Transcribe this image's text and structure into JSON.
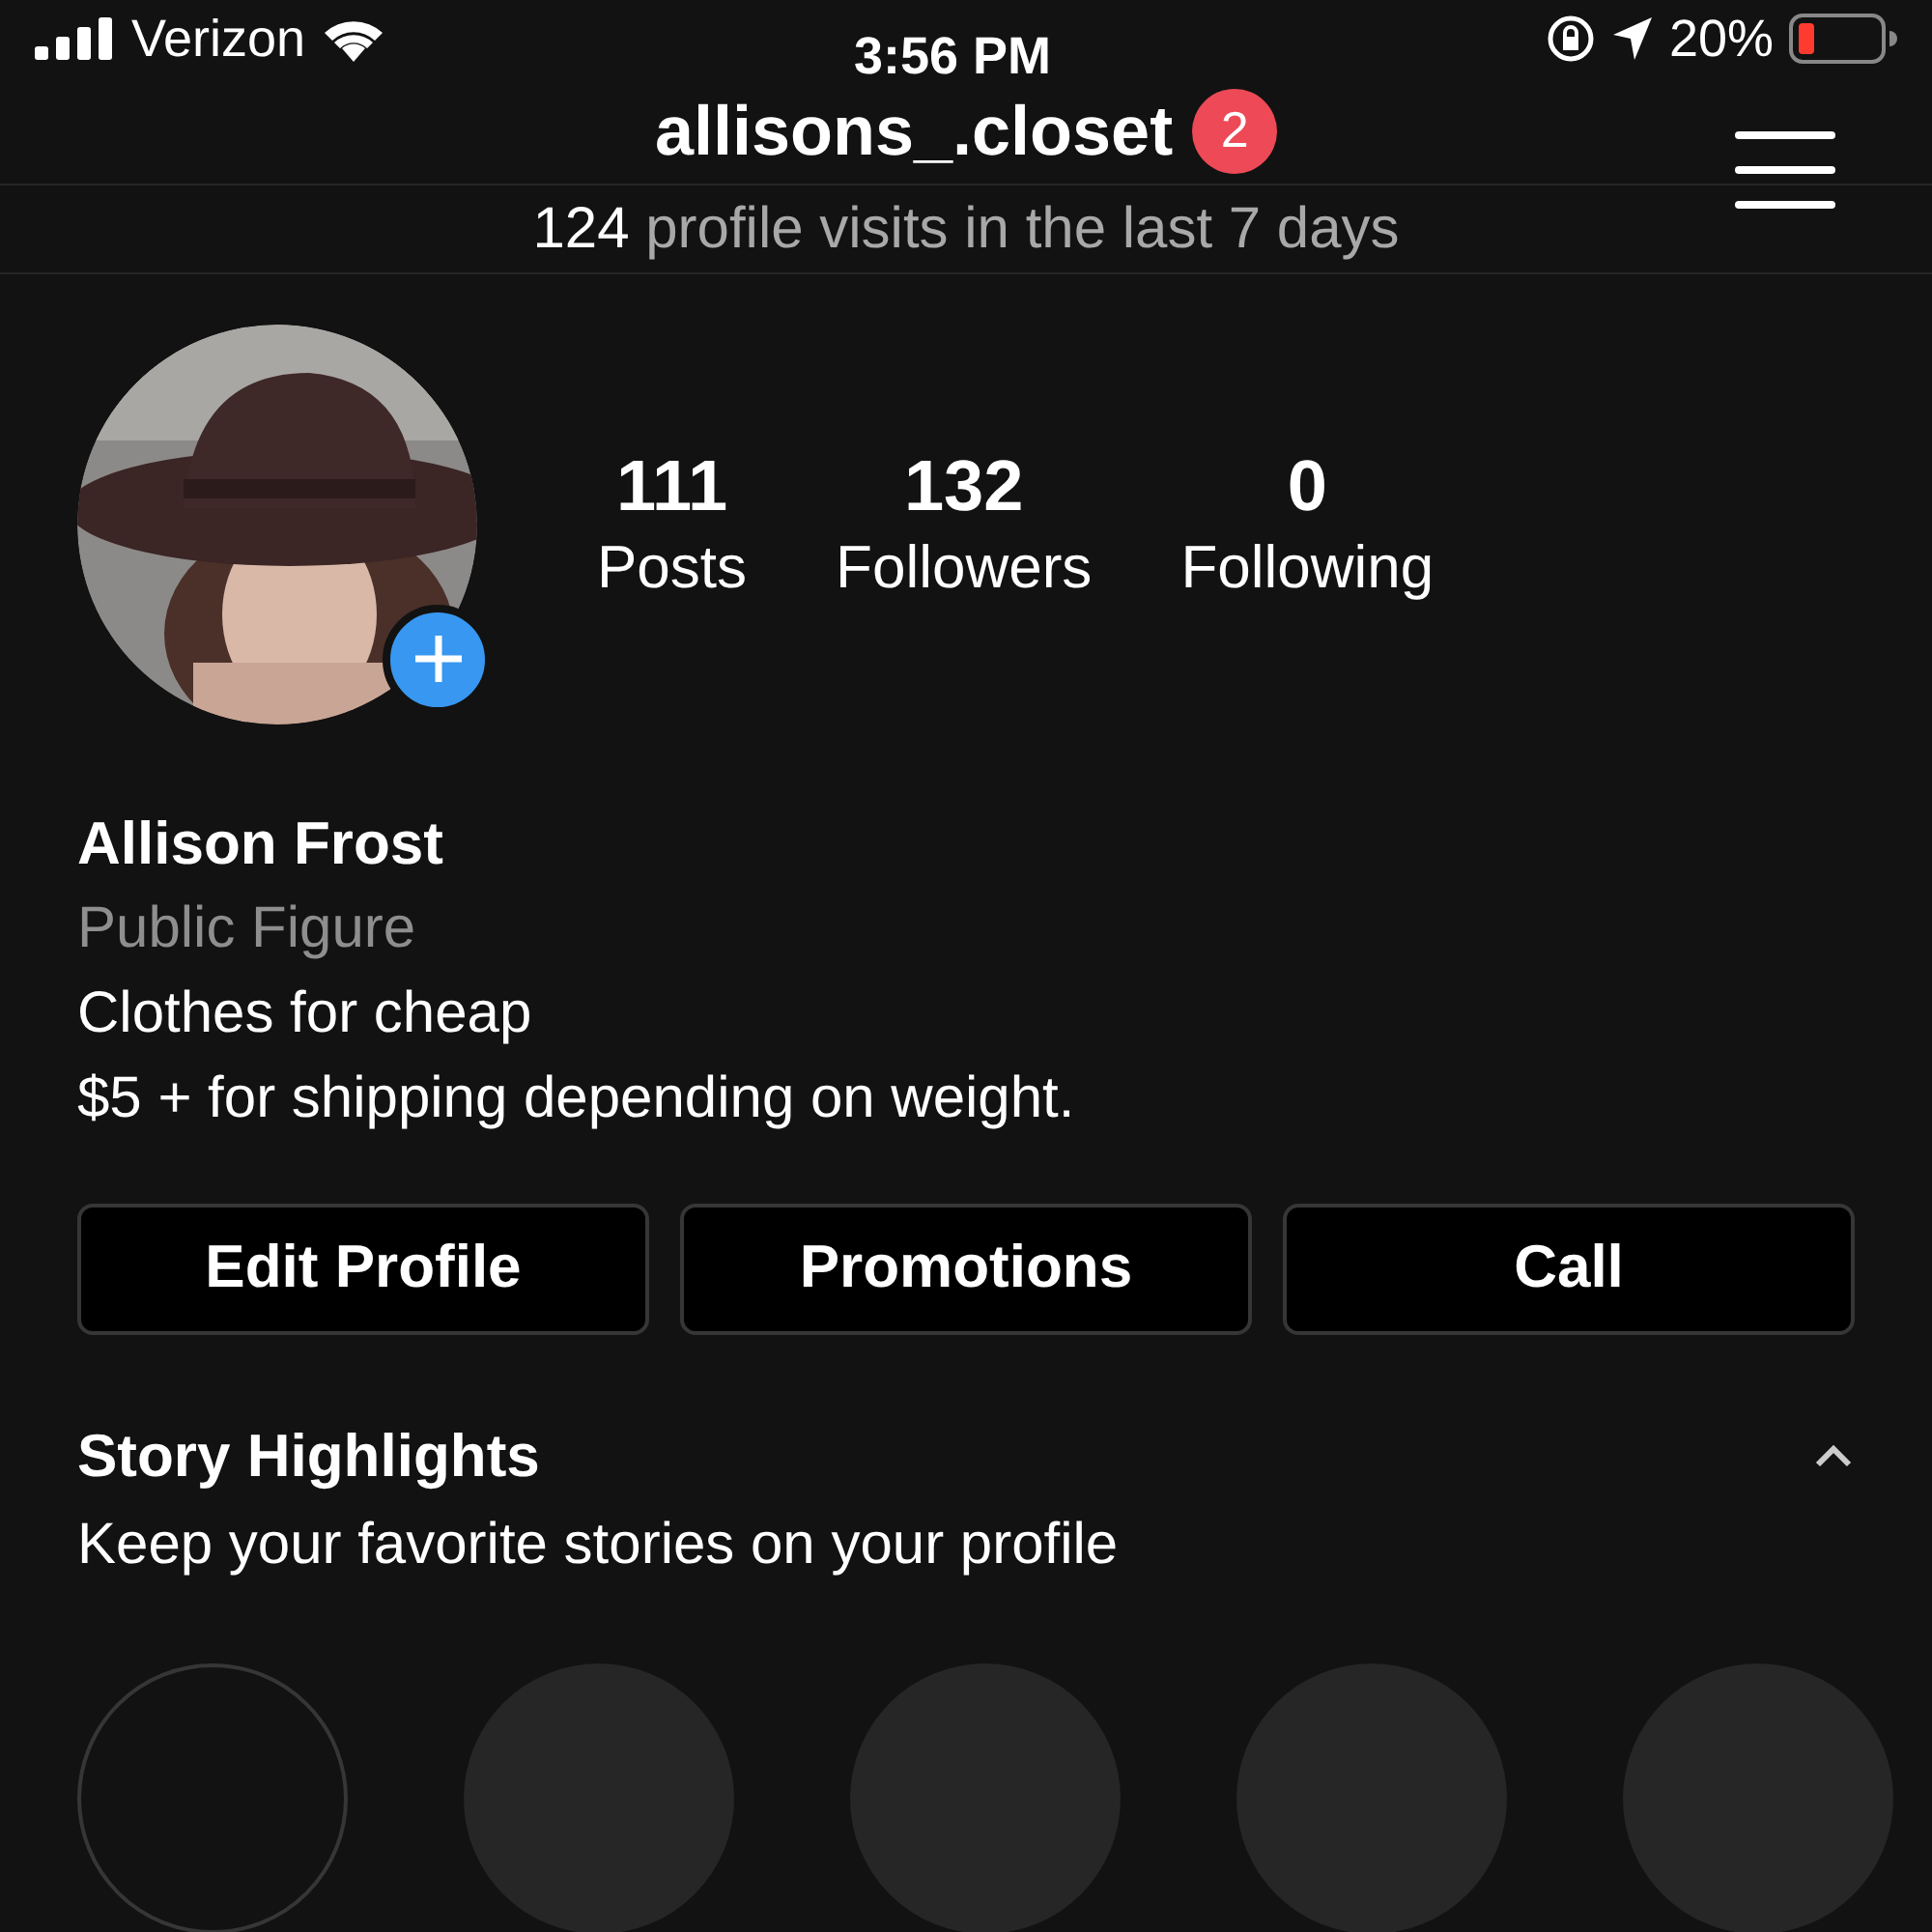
{
  "status_bar": {
    "carrier": "Verizon",
    "time": "3:56 PM",
    "battery": "20%"
  },
  "header": {
    "username": "allisons_.closet",
    "badge": "2"
  },
  "visits": {
    "count": "124",
    "text": "profile visits in the last 7 days"
  },
  "stats": [
    {
      "value": "111",
      "label": "Posts"
    },
    {
      "value": "132",
      "label": "Followers"
    },
    {
      "value": "0",
      "label": "Following"
    }
  ],
  "bio": {
    "name": "Allison Frost",
    "category": "Public Figure",
    "lines": [
      "Clothes for cheap",
      "$5 + for shipping depending on weight."
    ]
  },
  "buttons": [
    "Edit Profile",
    "Promotions",
    "Call"
  ],
  "highlights": {
    "title": "Story Highlights",
    "subtitle": "Keep your favorite stories on your profile",
    "expanded": true,
    "items": [
      {
        "kind": "new"
      },
      {
        "kind": "placeholder"
      },
      {
        "kind": "placeholder"
      },
      {
        "kind": "placeholder"
      },
      {
        "kind": "placeholder"
      }
    ]
  }
}
